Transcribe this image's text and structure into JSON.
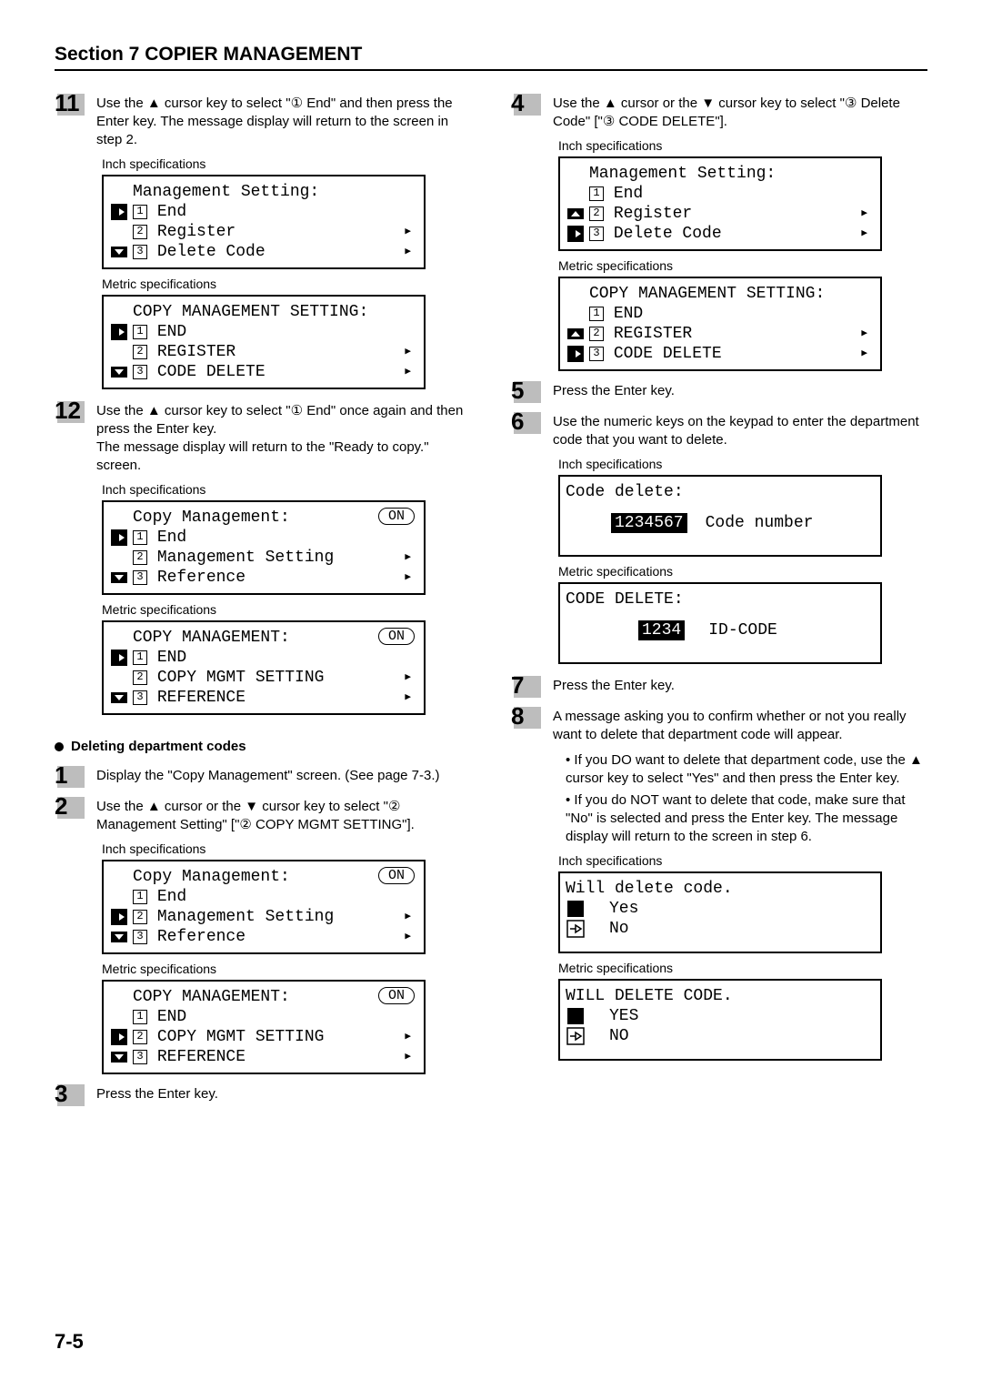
{
  "section_title": "Section 7  COPIER MANAGEMENT",
  "page_number": "7-5",
  "left": {
    "step11": {
      "num": "11",
      "text": "Use the ▲ cursor key to select \"① End\" and then press the Enter key. The message display will return to the screen in step 2.",
      "inch_label": "Inch specifications",
      "inch_lcd_title": "Management Setting:",
      "inch_1": "End",
      "inch_2": "Register",
      "inch_3": "Delete Code",
      "metric_label": "Metric specifications",
      "metric_lcd_title": "COPY MANAGEMENT SETTING:",
      "metric_1": "END",
      "metric_2": "REGISTER",
      "metric_3": "CODE DELETE"
    },
    "step12": {
      "num": "12",
      "text1": "Use the ▲ cursor key to select \"① End\" once again and then press the Enter key.",
      "text2": "The message display will return to the \"Ready to copy.\" screen.",
      "inch_label": "Inch specifications",
      "inch_lcd_title": "Copy Management:",
      "inch_on": "ON",
      "inch_1": "End",
      "inch_2": "Management Setting",
      "inch_3": "Reference",
      "metric_label": "Metric specifications",
      "metric_lcd_title": "COPY MANAGEMENT:",
      "metric_on": "ON",
      "metric_1": "END",
      "metric_2": "COPY MGMT SETTING",
      "metric_3": "REFERENCE"
    },
    "subheading": "Deleting department codes",
    "delstep1": {
      "num": "1",
      "text": "Display the \"Copy Management\" screen. (See page 7-3.)"
    },
    "delstep2": {
      "num": "2",
      "text": "Use the ▲ cursor or the ▼ cursor key to select \"② Management Setting\" [\"② COPY MGMT SETTING\"].",
      "inch_label": "Inch specifications",
      "inch_lcd_title": "Copy Management:",
      "inch_on": "ON",
      "inch_1": "End",
      "inch_2": "Management Setting",
      "inch_3": "Reference",
      "metric_label": "Metric specifications",
      "metric_lcd_title": "COPY MANAGEMENT:",
      "metric_on": "ON",
      "metric_1": "END",
      "metric_2": "COPY MGMT SETTING",
      "metric_3": "REFERENCE"
    },
    "delstep3": {
      "num": "3",
      "text": "Press the Enter key."
    }
  },
  "right": {
    "step4": {
      "num": "4",
      "text": "Use the ▲ cursor or the ▼ cursor key to select \"③ Delete Code\" [\"③ CODE DELETE\"].",
      "inch_label": "Inch specifications",
      "inch_lcd_title": "Management Setting:",
      "inch_1": "End",
      "inch_2": "Register",
      "inch_3": "Delete Code",
      "metric_label": "Metric specifications",
      "metric_lcd_title": "COPY MANAGEMENT SETTING:",
      "metric_1": "END",
      "metric_2": "REGISTER",
      "metric_3": "CODE DELETE"
    },
    "step5": {
      "num": "5",
      "text": "Press the Enter key."
    },
    "step6": {
      "num": "6",
      "text": "Use the numeric keys on the keypad to enter the department code that you want to delete.",
      "inch_label": "Inch specifications",
      "inch_lcd_title": "Code delete:",
      "inch_code": "1234567",
      "inch_code_label": "Code number",
      "metric_label": "Metric specifications",
      "metric_lcd_title": "CODE DELETE:",
      "metric_code": "1234",
      "metric_code_label": "ID-CODE"
    },
    "step7": {
      "num": "7",
      "text": "Press the Enter key."
    },
    "step8": {
      "num": "8",
      "text": "A message asking you to confirm whether or not you really want to delete that department code will appear.",
      "bullet1": "If you DO want to delete that department code, use the ▲ cursor key to select \"Yes\" and then press the Enter key.",
      "bullet2": "If you do NOT want to delete that code, make sure that \"No\" is selected and press the Enter key. The message display will return to the screen in step 6.",
      "inch_label": "Inch specifications",
      "inch_lcd_title": "Will delete code.",
      "inch_yes": "Yes",
      "inch_no": "No",
      "metric_label": "Metric specifications",
      "metric_lcd_title": "WILL DELETE CODE.",
      "metric_yes": "YES",
      "metric_no": "NO"
    }
  }
}
